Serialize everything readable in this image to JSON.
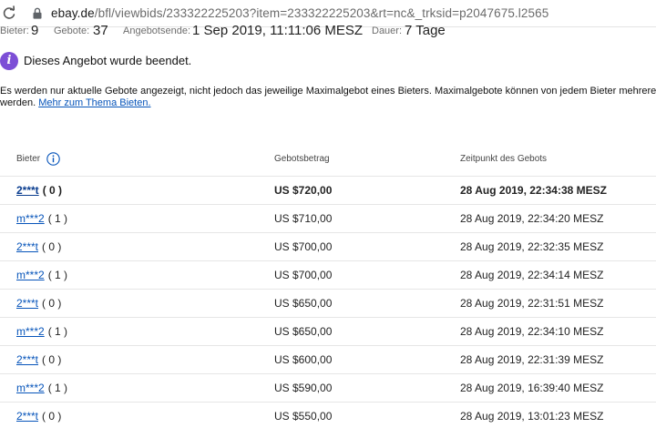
{
  "browser": {
    "url_host": "ebay.de",
    "url_path": "/bfl/viewbids/233322225203?item=233322225203&rt=nc&_trksid=p2047675.l2565"
  },
  "summary": {
    "bidders_label": "Bieter:",
    "bidders_value": "9",
    "bids_label": "Gebote:",
    "bids_value": "37",
    "end_label": "Angebotsende:",
    "end_value": "1 Sep 2019, 11:11:06 MESZ",
    "duration_label": "Dauer:",
    "duration_value": "7 Tage"
  },
  "notice": {
    "icon_glyph": "i",
    "text": "Dieses Angebot wurde beendet."
  },
  "description": {
    "line1": "Es werden nur aktuelle Gebote angezeigt, nicht jedoch das jeweilige Maximalgebot eines Bieters. Maximalgebote können von jedem Bieter mehrere Tage",
    "line2_prefix": "werden. ",
    "link": "Mehr zum Thema Bieten."
  },
  "table": {
    "headers": {
      "bidder": "Bieter",
      "amount": "Gebotsbetrag",
      "time": "Zeitpunkt des Gebots"
    },
    "rows": [
      {
        "bidder": "2***t",
        "score": "( 0 )",
        "amount": "US $720,00",
        "time": "28 Aug 2019, 22:34:38 MESZ"
      },
      {
        "bidder": "m***2",
        "score": "( 1 )",
        "amount": "US $710,00",
        "time": "28 Aug 2019, 22:34:20 MESZ"
      },
      {
        "bidder": "2***t",
        "score": "( 0 )",
        "amount": "US $700,00",
        "time": "28 Aug 2019, 22:32:35 MESZ"
      },
      {
        "bidder": "m***2",
        "score": "( 1 )",
        "amount": "US $700,00",
        "time": "28 Aug 2019, 22:34:14 MESZ"
      },
      {
        "bidder": "2***t",
        "score": "( 0 )",
        "amount": "US $650,00",
        "time": "28 Aug 2019, 22:31:51 MESZ"
      },
      {
        "bidder": "m***2",
        "score": "( 1 )",
        "amount": "US $650,00",
        "time": "28 Aug 2019, 22:34:10 MESZ"
      },
      {
        "bidder": "2***t",
        "score": "( 0 )",
        "amount": "US $600,00",
        "time": "28 Aug 2019, 22:31:39 MESZ"
      },
      {
        "bidder": "m***2",
        "score": "( 1 )",
        "amount": "US $590,00",
        "time": "28 Aug 2019, 16:39:40 MESZ"
      },
      {
        "bidder": "2***t",
        "score": "( 0 )",
        "amount": "US $550,00",
        "time": "28 Aug 2019, 13:01:23 MESZ"
      }
    ]
  },
  "colors": {
    "link": "#0654ba",
    "badge": "#7c4ed6"
  }
}
